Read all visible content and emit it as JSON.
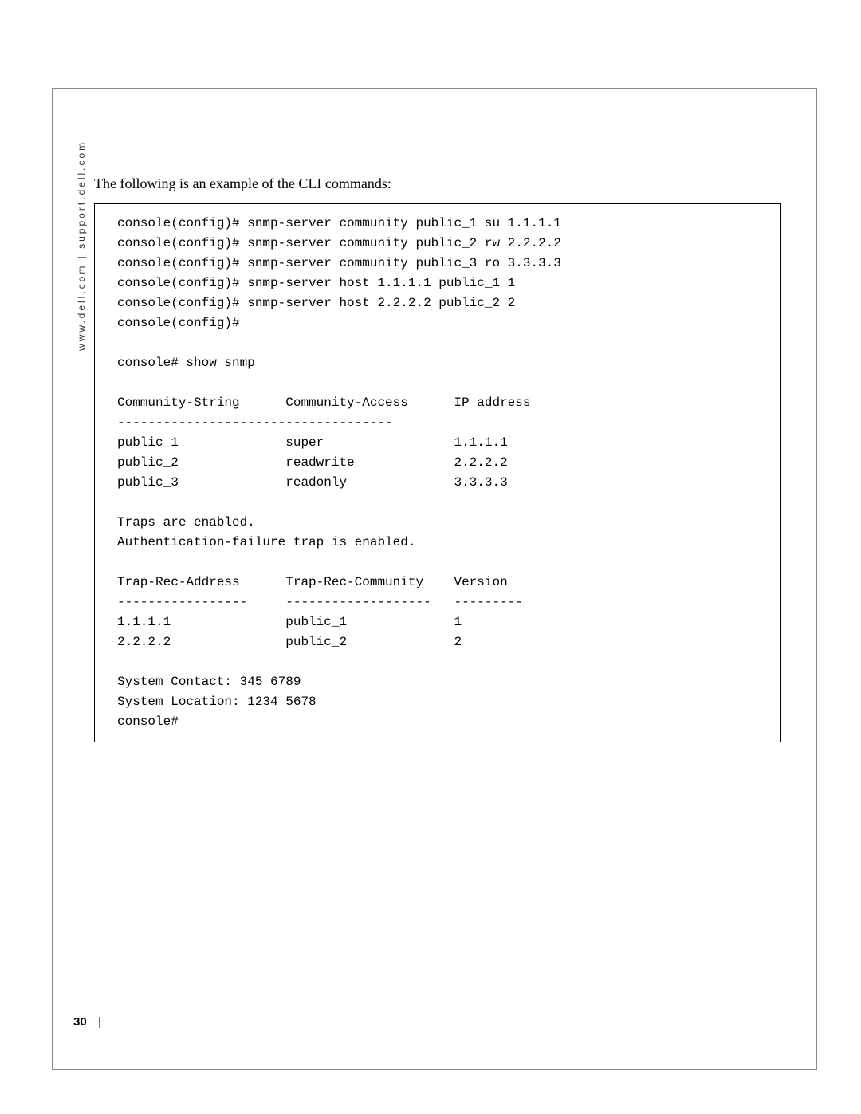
{
  "sidebar": {
    "text": "www.dell.com | support.dell.com"
  },
  "intro": "The following is an example of the CLI commands:",
  "cli": {
    "lines": [
      "console(config)# snmp-server community public_1 su 1.1.1.1",
      "console(config)# snmp-server community public_2 rw 2.2.2.2",
      "console(config)# snmp-server community public_3 ro 3.3.3.3",
      "console(config)# snmp-server host 1.1.1.1 public_1 1",
      "console(config)# snmp-server host 2.2.2.2 public_2 2",
      "console(config)#"
    ],
    "show_cmd": "console# show snmp",
    "community": {
      "headers": [
        "Community-String",
        "Community-Access",
        "IP address"
      ],
      "divider": "------------------------------------",
      "rows": [
        [
          "public_1",
          "super",
          "1.1.1.1"
        ],
        [
          "public_2",
          "readwrite",
          "2.2.2.2"
        ],
        [
          "public_3",
          "readonly",
          "3.3.3.3"
        ]
      ]
    },
    "traps_line1": "Traps are enabled.",
    "traps_line2": "Authentication-failure trap is enabled.",
    "trap": {
      "headers": [
        "Trap-Rec-Address",
        "Trap-Rec-Community",
        "Version"
      ],
      "dividers": [
        "-----------------",
        "-------------------",
        "---------"
      ],
      "rows": [
        [
          "1.1.1.1",
          "public_1",
          "1"
        ],
        [
          "2.2.2.2",
          "public_2",
          "2"
        ]
      ]
    },
    "footer": [
      "System Contact: 345 6789",
      "System Location: 1234 5678",
      "console#"
    ]
  },
  "page_number": "30"
}
